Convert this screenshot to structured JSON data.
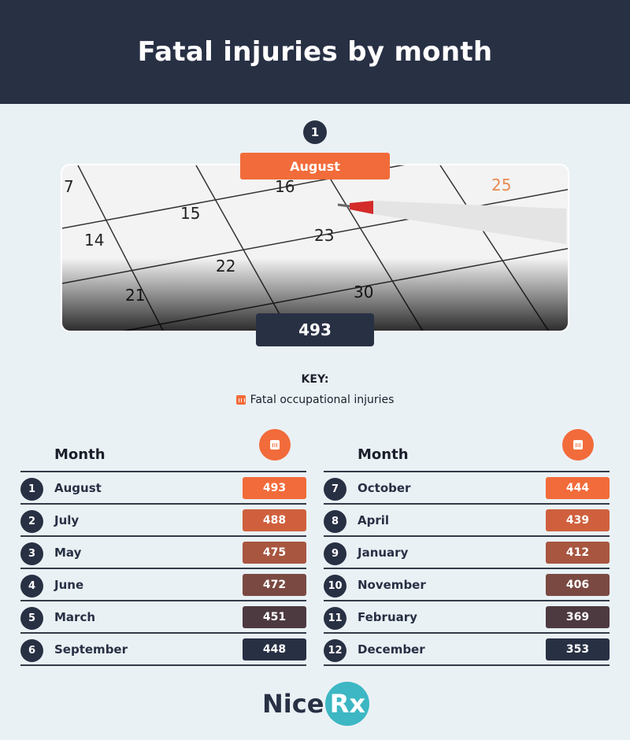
{
  "title": "Fatal injuries by month",
  "highlight": {
    "rank": "1",
    "month": "August",
    "value": "493"
  },
  "key": {
    "title": "KEY:",
    "item": "Fatal occupational injuries",
    "icon": "bar-chart-icon"
  },
  "colors": {
    "header": "#283044",
    "accent": "#f26b3a",
    "background": "#eaf1f5",
    "logo_accent": "#3cb7c3"
  },
  "chart_data": {
    "type": "table",
    "column_header": "Month",
    "series_name": "Fatal occupational injuries",
    "left": [
      {
        "rank": "1",
        "month": "August",
        "value": "493",
        "color": "#f26b3a"
      },
      {
        "rank": "2",
        "month": "July",
        "value": "488",
        "color": "#d0603d"
      },
      {
        "rank": "3",
        "month": "May",
        "value": "475",
        "color": "#a85640"
      },
      {
        "rank": "4",
        "month": "June",
        "value": "472",
        "color": "#7a4a42"
      },
      {
        "rank": "5",
        "month": "March",
        "value": "451",
        "color": "#4d3a40"
      },
      {
        "rank": "6",
        "month": "September",
        "value": "448",
        "color": "#283044"
      }
    ],
    "right": [
      {
        "rank": "7",
        "month": "October",
        "value": "444",
        "color": "#f26b3a"
      },
      {
        "rank": "8",
        "month": "April",
        "value": "439",
        "color": "#d0603d"
      },
      {
        "rank": "9",
        "month": "January",
        "value": "412",
        "color": "#a85640"
      },
      {
        "rank": "10",
        "month": "November",
        "value": "406",
        "color": "#7a4a42"
      },
      {
        "rank": "11",
        "month": "February",
        "value": "369",
        "color": "#4d3a40"
      },
      {
        "rank": "12",
        "month": "December",
        "value": "353",
        "color": "#283044"
      }
    ]
  },
  "calendar_numbers": [
    "7",
    "15",
    "16",
    "14",
    "23",
    "25",
    "22",
    "21",
    "30"
  ],
  "logo": {
    "left": "Nice",
    "right": "Rx"
  }
}
